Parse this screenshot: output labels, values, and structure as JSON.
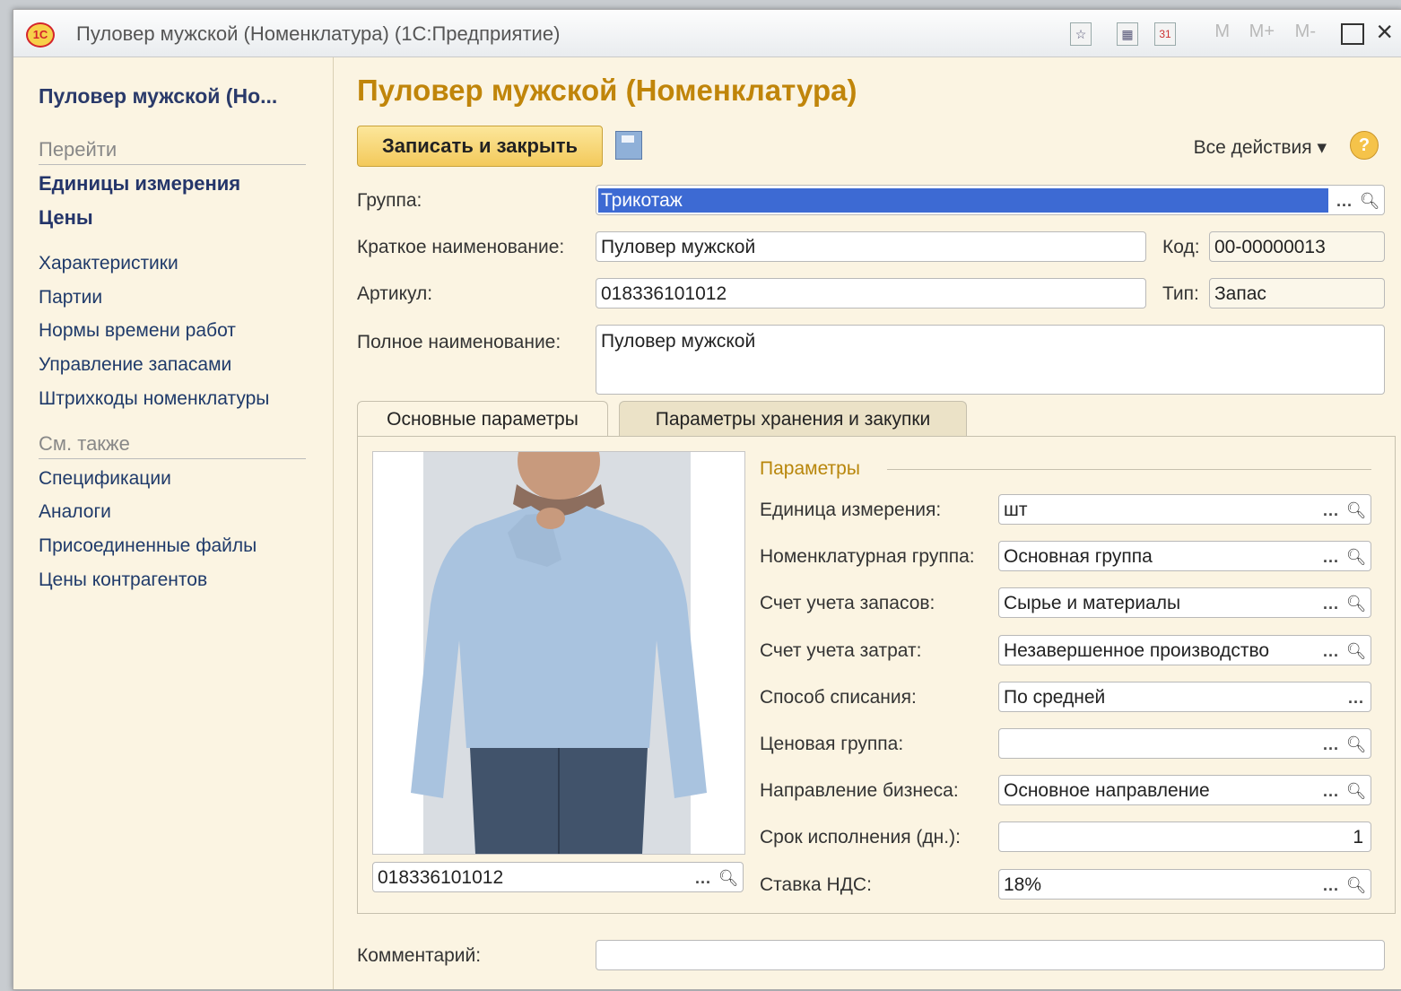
{
  "window": {
    "title": "Пуловер мужской (Номенклатура)  (1С:Предприятие)",
    "logo_text": "1С",
    "toolbar_m": [
      "M",
      "M+",
      "M-"
    ]
  },
  "sidebar": {
    "title": "Пуловер мужской (Но...",
    "goto_label": "Перейти",
    "goto_items": [
      "Единицы измерения",
      "Цены",
      "Характеристики",
      "Партии",
      "Нормы времени работ",
      "Управление запасами",
      "Штрихкоды номенклатуры"
    ],
    "see_also_label": "См. также",
    "see_also_items": [
      "Спецификации",
      "Аналоги",
      "Присоединенные файлы",
      "Цены контрагентов"
    ]
  },
  "main": {
    "title": "Пуловер мужской (Номенклатура)",
    "save_close_label": "Записать и закрыть",
    "all_actions_label": "Все действия ▾",
    "help_label": "?",
    "fields": {
      "group": {
        "label": "Группа:",
        "value": "Трикотаж"
      },
      "short_name": {
        "label": "Краткое наименование:",
        "value": "Пуловер мужской"
      },
      "code": {
        "label": "Код:",
        "value": "00-00000013"
      },
      "article": {
        "label": "Артикул:",
        "value": "018336101012"
      },
      "type": {
        "label": "Тип:",
        "value": "Запас"
      },
      "full_name": {
        "label": "Полное наименование:",
        "value": "Пуловер мужской"
      }
    },
    "tabs": [
      {
        "label": "Основные параметры",
        "active": true
      },
      {
        "label": "Параметры хранения и закупки",
        "active": false
      }
    ],
    "image_code": "018336101012",
    "params_legend": "Параметры",
    "params": [
      {
        "label": "Единица измерения:",
        "value": "шт"
      },
      {
        "label": "Номенклатурная группа:",
        "value": "Основная группа"
      },
      {
        "label": "Счет учета запасов:",
        "value": "Сырье и материалы"
      },
      {
        "label": "Счет учета затрат:",
        "value": "Незавершенное производство"
      },
      {
        "label": "Способ списания:",
        "value": "По средней"
      },
      {
        "label": "Ценовая группа:",
        "value": ""
      },
      {
        "label": "Направление бизнеса:",
        "value": "Основное направление"
      },
      {
        "label": "Срок исполнения (дн.):",
        "value": "1"
      },
      {
        "label": "Ставка НДС:",
        "value": "18%"
      }
    ],
    "comment_label": "Комментарий:",
    "comment_value": ""
  }
}
